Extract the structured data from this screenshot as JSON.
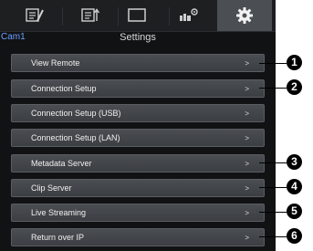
{
  "tabs": [
    {
      "name": "tab-edit-list",
      "icon": "edit-list-icon"
    },
    {
      "name": "tab-upload-list",
      "icon": "upload-list-icon"
    },
    {
      "name": "tab-display",
      "icon": "display-icon"
    },
    {
      "name": "tab-camera-settings",
      "icon": "camera-gear-icon"
    },
    {
      "name": "tab-settings",
      "icon": "gear-icon",
      "active": true
    }
  ],
  "header": {
    "camera": "Cam1",
    "title": "Settings"
  },
  "menu": {
    "items": [
      {
        "label": "View Remote",
        "chevron": ">",
        "callout": "1"
      },
      {
        "label": "Connection Setup",
        "chevron": ">",
        "callout": "2"
      },
      {
        "label": "Connection Setup (USB)",
        "chevron": ">",
        "callout": ""
      },
      {
        "label": "Connection Setup (LAN)",
        "chevron": ">",
        "callout": ""
      },
      {
        "label": "Metadata Server",
        "chevron": ">",
        "callout": "3"
      },
      {
        "label": "Clip Server",
        "chevron": ">",
        "callout": "4"
      },
      {
        "label": "Live Streaming",
        "chevron": ">",
        "callout": "5"
      },
      {
        "label": "Return over IP",
        "chevron": ">",
        "callout": "6"
      }
    ]
  },
  "colors": {
    "camera_label": "#6aa0ff",
    "active_tab": "#4b4f54",
    "screen_bg": "#111214"
  }
}
